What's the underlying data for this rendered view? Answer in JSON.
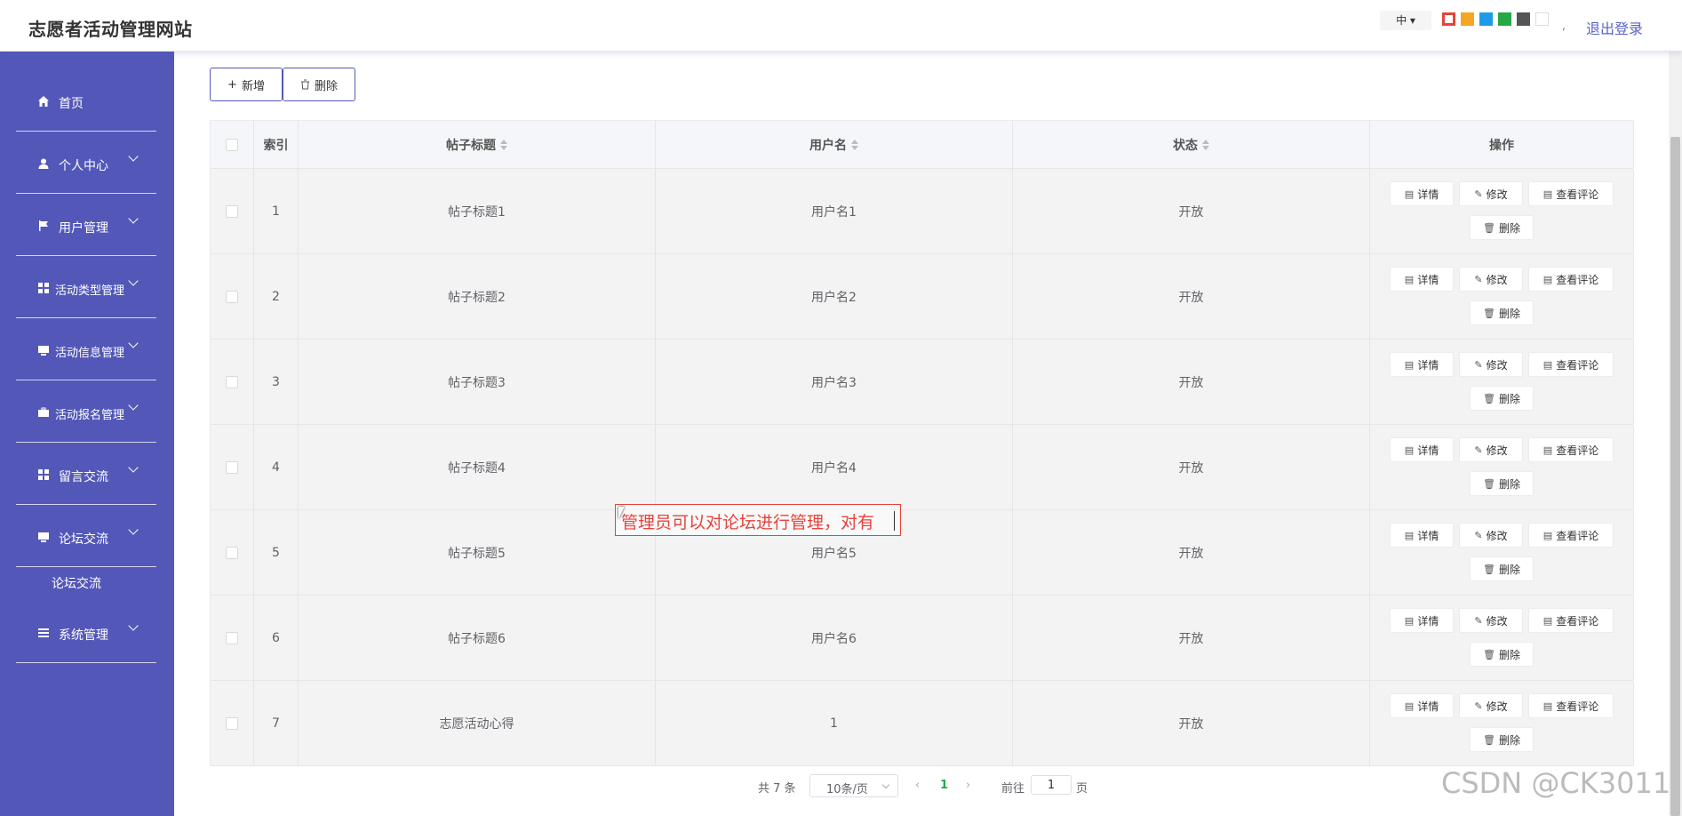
{
  "header": {
    "title": "志愿者活动管理网站",
    "lang": "中 ▾",
    "swatches": [
      "#ffffff",
      "#f5a623",
      "#1e9be6",
      "#27a844",
      "#555555",
      "#ffffff"
    ],
    "comma": ",",
    "logout": "退出登录"
  },
  "sidebar": {
    "items": [
      {
        "label": "首页",
        "icon": "home-icon"
      },
      {
        "label": "个人中心",
        "icon": "user-icon"
      },
      {
        "label": "用户管理",
        "icon": "flag-icon"
      },
      {
        "label": "活动类型管理",
        "icon": "grid-icon"
      },
      {
        "label": "活动信息管理",
        "icon": "monitor-icon"
      },
      {
        "label": "活动报名管理",
        "icon": "briefcase-icon"
      },
      {
        "label": "留言交流",
        "icon": "grid-icon"
      },
      {
        "label": "论坛交流",
        "icon": "monitor-icon"
      },
      {
        "label": "系统管理",
        "icon": "list-icon"
      }
    ],
    "subitem": "论坛交流"
  },
  "toolbar": {
    "add_label": "新增",
    "delete_label": "删除"
  },
  "table": {
    "columns": [
      "索引",
      "帖子标题",
      "用户名",
      "状态",
      "操作"
    ],
    "rows": [
      {
        "index": "1",
        "title": "帖子标题1",
        "user": "用户名1",
        "status": "开放"
      },
      {
        "index": "2",
        "title": "帖子标题2",
        "user": "用户名2",
        "status": "开放"
      },
      {
        "index": "3",
        "title": "帖子标题3",
        "user": "用户名3",
        "status": "开放"
      },
      {
        "index": "4",
        "title": "帖子标题4",
        "user": "用户名4",
        "status": "开放"
      },
      {
        "index": "5",
        "title": "帖子标题5",
        "user": "用户名5",
        "status": "开放"
      },
      {
        "index": "6",
        "title": "帖子标题6",
        "user": "用户名6",
        "status": "开放"
      },
      {
        "index": "7",
        "title": "志愿活动心得",
        "user": "1",
        "status": "开放"
      }
    ],
    "actions": {
      "detail": "详情",
      "edit": "修改",
      "comments": "查看评论",
      "delete": "删除"
    }
  },
  "pagination": {
    "total": "共 7 条",
    "page_size": "10条/页",
    "current": "1",
    "goto_label": "前往",
    "goto_value": "1",
    "page_suffix": "页"
  },
  "annotation": "管理员可以对论坛进行管理，对有",
  "watermark": "CSDN @CK3011"
}
